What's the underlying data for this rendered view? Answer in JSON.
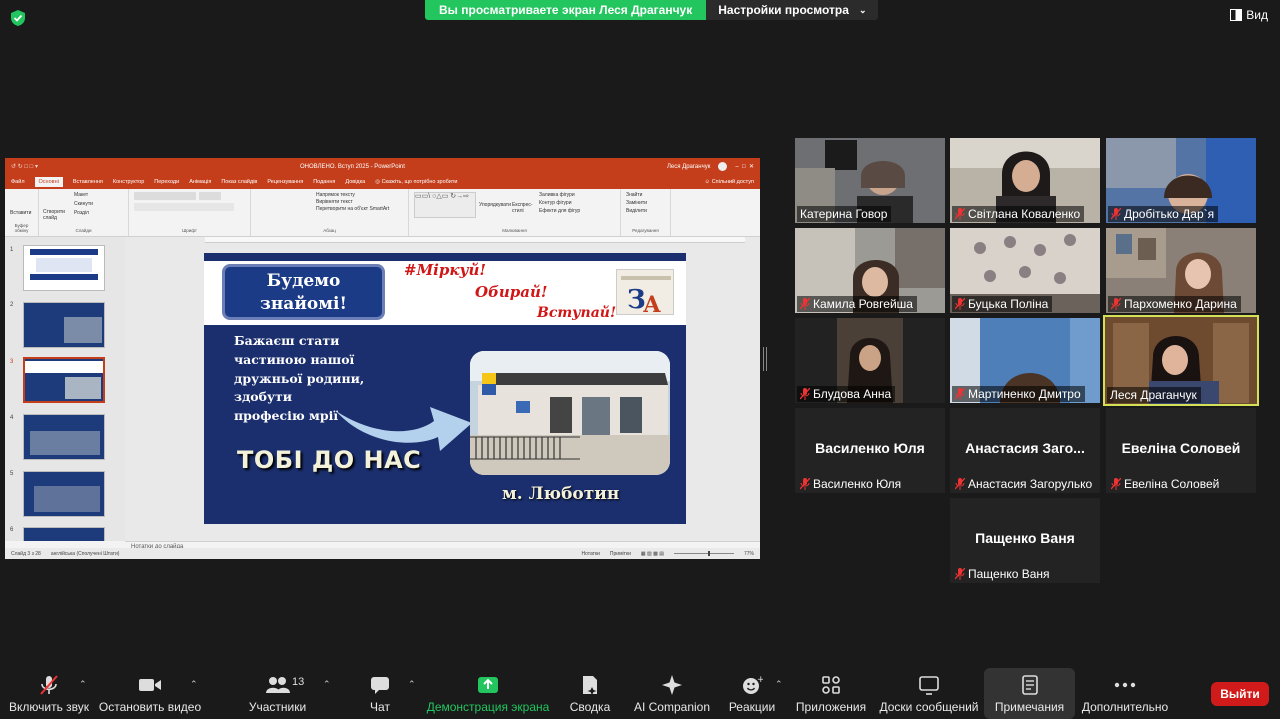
{
  "topbar": {
    "share_banner": "Вы просматриваете экран Леся Драганчук",
    "view_options": "Настройки просмотра",
    "view_button": "Вид"
  },
  "ppt": {
    "window_title": "ОНОВЛЕНО. Вступ 2025 - PowerPoint",
    "user": "Леся Драганчук",
    "tabs": [
      "Файл",
      "Основні",
      "Вставлення",
      "Конструктор",
      "Переходи",
      "Анімація",
      "Показ слайдів",
      "Рецензування",
      "Подання",
      "Довідка",
      "Скажіть, що потрібно зробити"
    ],
    "share_label": "Спільний доступ",
    "ribbon_groups": [
      "Буфер обміну",
      "Слайди",
      "Шрифт",
      "Абзац",
      "Малювання",
      "Редагування"
    ],
    "ribbon_items": {
      "paste": "Вставити",
      "new_slide": "Створити слайд",
      "layout": "Макет",
      "reset": "Скинути",
      "section": "Розділ",
      "text_direction": "Напрямок тексту",
      "align_text": "Вирівняти текст",
      "smartart": "Перетворити на об'єкт SmartArt",
      "arrange": "Упорядкувати",
      "quick_styles": "Експрес-стилі",
      "shape_fill": "Заливка фігури",
      "shape_outline": "Контур фігури",
      "shape_effects": "Ефекти для фігур",
      "find": "Знайти",
      "replace": "Замінити",
      "select": "Виділити"
    },
    "thumb_numbers": [
      "1",
      "2",
      "3",
      "4",
      "5",
      "6"
    ],
    "notes": "Нотатки до слайда",
    "status_slide": "Слайд 3 з 28",
    "status_lang": "англійська (Сполучені Штати)",
    "status_notes": "Нотатки",
    "status_comments": "Примітки",
    "zoom": "77%"
  },
  "slide": {
    "welcome": "Будемо знайомі!",
    "tag1": "#Міркуй!",
    "tag2": "Обирай!",
    "tag3": "Вступай!",
    "line1": "Бажаєш стати",
    "line2": "частиною нашої",
    "line3": "дружньої родини,",
    "line4": "здобути",
    "line5": "професію мрії",
    "big": "ТОБІ ДО НАС",
    "city": "м. Люботин"
  },
  "participants": [
    {
      "name": "Катерина Говор",
      "muted": false
    },
    {
      "name": "Світлана Коваленко",
      "muted": true
    },
    {
      "name": "Дробітько Дар`я",
      "muted": true
    },
    {
      "name": "Камила Ровгейша",
      "muted": true
    },
    {
      "name": "Буцька Поліна",
      "muted": true
    },
    {
      "name": "Пархоменко Дарина",
      "muted": true
    },
    {
      "name": "Блудова Анна",
      "muted": true
    },
    {
      "name": "Мартиненко Дмитро",
      "muted": true
    },
    {
      "name": "Леся Драганчук",
      "muted": false
    },
    {
      "name": "Василенко Юля",
      "big": "Василенко Юля",
      "muted": true
    },
    {
      "name": "Анастасия Загорулько",
      "big": "Анастасия Заго...",
      "muted": true
    },
    {
      "name": "Евеліна Соловей",
      "big": "Евеліна Соловей",
      "muted": true
    },
    {
      "name": "Пащенко Ваня",
      "big": "Пащенко Ваня",
      "muted": true
    }
  ],
  "toolbar": {
    "mute": "Включить звук",
    "video": "Остановить видео",
    "participants": "Участники",
    "participants_count": "13",
    "chat": "Чат",
    "share": "Демонстрация экрана",
    "summary": "Сводка",
    "ai": "AI Companion",
    "reactions": "Реакции",
    "apps": "Приложения",
    "whiteboards": "Доски сообщений",
    "notes": "Примечания",
    "more": "Дополнительно",
    "leave": "Выйти"
  },
  "colors": {
    "zoom_green": "#22c55e",
    "leave_red": "#d11a1a",
    "ppt_orange": "#c43e1c",
    "slide_navy": "#1b2f6e",
    "active_speaker": "#d4e157"
  }
}
